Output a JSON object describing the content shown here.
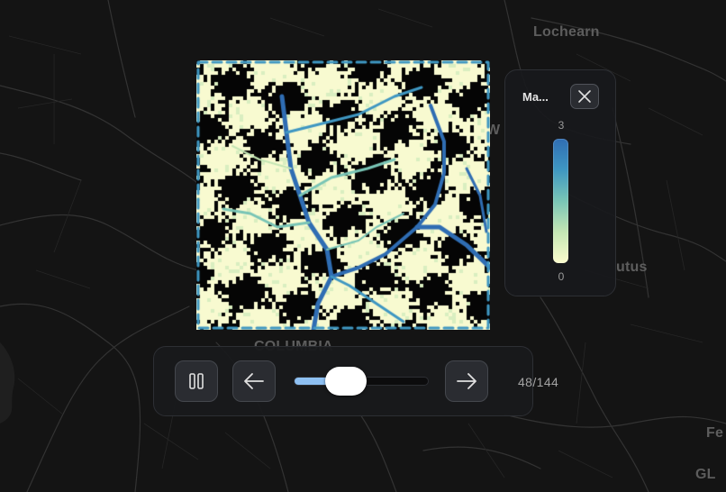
{
  "map": {
    "labels": [
      {
        "name": "map-label-lochearn",
        "text": "Lochearn"
      },
      {
        "name": "map-label-columbia",
        "text": "COLUMBIA"
      },
      {
        "name": "map-label-w",
        "text": "W"
      },
      {
        "name": "map-label-utus",
        "text": "utus"
      },
      {
        "name": "map-label-fe",
        "text": "Fe"
      },
      {
        "name": "map-label-gl",
        "text": "GL"
      }
    ]
  },
  "legend": {
    "title": "Ma...",
    "max_label": "3",
    "min_label": "0",
    "colors": [
      "#2f6db3",
      "#3f97c2",
      "#79c5b6",
      "#c4e6b4",
      "#fbfccd"
    ],
    "close_icon": "close-icon"
  },
  "playback": {
    "pause_icon": "pause-icon",
    "prev_icon": "arrow-left-icon",
    "next_icon": "arrow-right-icon",
    "current": 48,
    "total": 144,
    "counter_text": "48/144",
    "accent_color": "#8ec0f2"
  }
}
